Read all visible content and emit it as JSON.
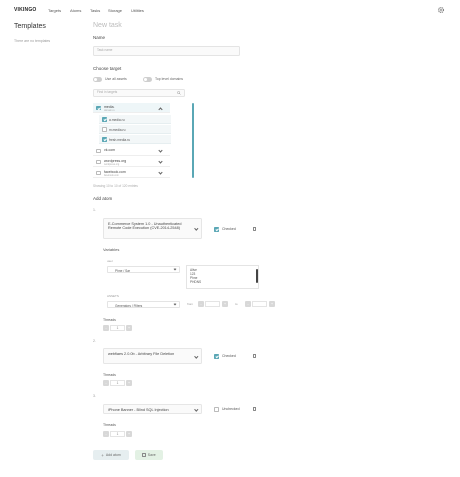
{
  "nav": {
    "logo": "VIKINGO",
    "items": [
      "Targets",
      "Atoms",
      "Tasks",
      "Storage",
      "Utilities"
    ]
  },
  "sidebar": {
    "title": "Templates",
    "empty": "There are no templates"
  },
  "main": {
    "title": "New task",
    "name_label": "Name",
    "name_placeholder": "Task name",
    "choose_target_label": "Choose target",
    "use_all_assets": "Use all assets",
    "top_level_domains": "Top level domains",
    "find_targets_placeholder": "Find in targets",
    "targets": [
      {
        "name": "media.",
        "sub": "domain.ru",
        "checked": true,
        "expanded": true,
        "children": [
          {
            "name": "a.media.ru",
            "checked": true
          },
          {
            "name": "m.media.ru",
            "checked": false
          },
          {
            "name": "fresh.media.ru",
            "checked": true
          }
        ]
      },
      {
        "name": "vk.com",
        "sub": "",
        "checked": false,
        "expanded": false
      },
      {
        "name": "wordpress.org",
        "sub": "wordpress.org",
        "checked": false,
        "expanded": false
      },
      {
        "name": "facebook.com",
        "sub": "facebook.com",
        "checked": false,
        "expanded": false
      }
    ],
    "showing_text": "Showing 10 to 10 of 120 entries",
    "add_atom_label": "Add atom",
    "variables_label": "Variables",
    "threads_label": "Threads",
    "atoms": [
      {
        "index": "1.",
        "title": "E-Commerce System 1.0 - Unauthenticated Remote Code Execution (CVE-2014-2548)",
        "check_label": "Checked",
        "checked": true
      },
      {
        "index": "2.",
        "title": "webfiaes 2.0.0b - Arbitrary File Deletion",
        "check_label": "Checked",
        "checked": true
      },
      {
        "index": "3.",
        "title": "iPhone Banner - Blind SQL Injection",
        "check_label": "Unchecked",
        "checked": false
      }
    ],
    "variables": {
      "user_label": "user",
      "user_select": "Phne / Sar",
      "list_items": [
        "Alive",
        "123",
        "Phne",
        "PHDNS"
      ],
      "assets_label": "ASSETS",
      "assets_select": "Generators / Filters",
      "from_label": "from",
      "to_label": "to",
      "from_value": "",
      "to_value": ""
    },
    "threads_value": "1",
    "add_atom_button": "Add atom",
    "save_button": "Save"
  },
  "colors": {
    "accent": "#5aa7b5"
  }
}
